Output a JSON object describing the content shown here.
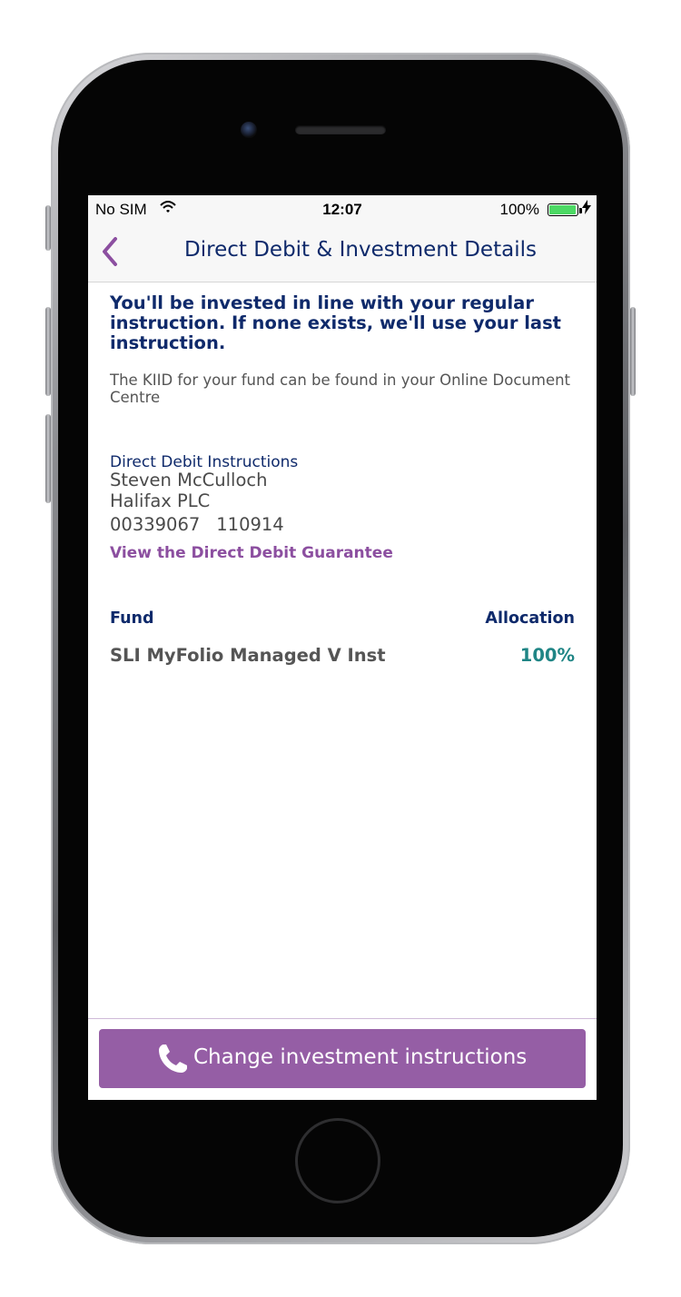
{
  "statusbar": {
    "carrier": "No SIM",
    "wifi_icon": "wifi-icon",
    "time": "12:07",
    "battery_percent": "100%",
    "battery_level": 1.0,
    "charging_icon": "bolt-icon"
  },
  "navbar": {
    "back_icon": "chevron-left-icon",
    "title": "Direct Debit & Investment Details"
  },
  "content": {
    "headline": "You'll be invested in line with your regular instruction. If none exists, we'll use your last instruction.",
    "kiid_note": "The KIID for your fund can be found in your Online Document Centre",
    "direct_debit": {
      "label": "Direct Debit Instructions",
      "name": "Steven McCulloch",
      "bank": "Halifax PLC",
      "account_number": "00339067",
      "sort_code": "110914",
      "guarantee_link": "View the Direct Debit Guarantee"
    },
    "funds": {
      "fund_header": "Fund",
      "allocation_header": "Allocation",
      "rows": [
        {
          "name": "SLI MyFolio Managed V Inst",
          "allocation": "100%"
        }
      ]
    }
  },
  "cta": {
    "icon": "phone-icon",
    "label": "Change investment instructions"
  },
  "colors": {
    "navy": "#0f2a6b",
    "purple": "#955ea5",
    "link_purple": "#8c4fa0",
    "teal": "#1f8585",
    "grey_text": "#555555"
  }
}
